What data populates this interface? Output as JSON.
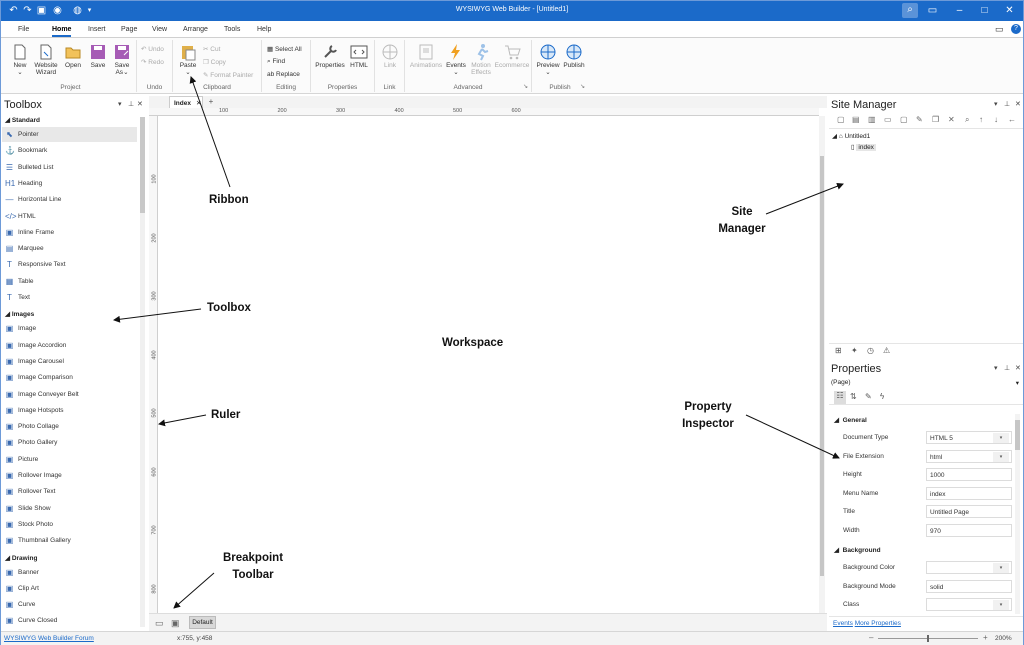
{
  "window": {
    "title": "WYSIWYG Web Builder - [Untitled1]"
  },
  "menu": [
    "File",
    "Home",
    "Insert",
    "Page",
    "View",
    "Arrange",
    "Tools",
    "Help"
  ],
  "menu_active": "Home",
  "ribbon": {
    "groups": [
      "Project",
      "Undo",
      "Clipboard",
      "Editing",
      "Properties",
      "Link",
      "Advanced",
      "Publish"
    ],
    "project": {
      "new": "New",
      "wizard1": "Website",
      "wizard2": "Wizard",
      "open": "Open",
      "save": "Save",
      "saveas1": "Save",
      "saveas2": "As"
    },
    "undo": {
      "undo": "Undo",
      "redo": "Redo"
    },
    "clipboard": {
      "paste": "Paste",
      "cut": "Cut",
      "copy": "Copy",
      "format_painter": "Format Painter"
    },
    "editing": {
      "select_all": "Select All",
      "find": "Find",
      "replace": "Replace"
    },
    "properties": {
      "properties": "Properties",
      "html": "HTML"
    },
    "link": {
      "link": "Link"
    },
    "advanced": {
      "animations": "Animations",
      "events": "Events",
      "motion1": "Motion",
      "motion2": "Effects",
      "ecommerce": "Ecommerce"
    },
    "publish": {
      "preview": "Preview",
      "publish": "Publish"
    }
  },
  "toolbox": {
    "title": "Toolbox",
    "sections": {
      "standard": "Standard",
      "images": "Images",
      "drawing": "Drawing"
    },
    "standard_items": [
      "Pointer",
      "Bookmark",
      "Bulleted List",
      "Heading",
      "Horizontal Line",
      "HTML",
      "Inline Frame",
      "Marquee",
      "Responsive Text",
      "Table",
      "Text"
    ],
    "image_items": [
      "Image",
      "Image Accordion",
      "Image Carousel",
      "Image Comparison",
      "Image Conveyer Belt",
      "Image Hotspots",
      "Photo Collage",
      "Photo Gallery",
      "Picture",
      "Rollover Image",
      "Rollover Text",
      "Slide Show",
      "Stock Photo",
      "Thumbnail Gallery"
    ],
    "drawing_items": [
      "Banner",
      "Clip Art",
      "Curve",
      "Curve Closed"
    ],
    "standard_icons": [
      "pointer-icon",
      "bookmark-icon",
      "list-icon",
      "heading-icon",
      "line-icon",
      "html-icon",
      "frame-icon",
      "marquee-icon",
      "text-icon",
      "table-icon",
      "text-icon"
    ],
    "standard_glyphs": [
      "⬉",
      "⚓",
      "☰",
      "H1",
      "—",
      "</>",
      "▣",
      "▤",
      "T",
      "▦",
      "T"
    ]
  },
  "document": {
    "tab": "Index",
    "add_tab": "+"
  },
  "ruler": {
    "h": [
      "100",
      "200",
      "300",
      "400",
      "500",
      "600"
    ],
    "v": [
      "100",
      "200",
      "300",
      "400",
      "500",
      "600",
      "700",
      "800"
    ]
  },
  "breakpoint": {
    "default": "Default"
  },
  "site_manager": {
    "title": "Site Manager",
    "root": "Untitled1",
    "page": "index"
  },
  "properties": {
    "title": "Properties",
    "object": "(Page)",
    "general": "General",
    "rows": [
      {
        "name": "Document Type",
        "value": "HTML 5",
        "dropdown": true
      },
      {
        "name": "File Extension",
        "value": "html",
        "dropdown": true
      },
      {
        "name": "Height",
        "value": "1000",
        "dropdown": false
      },
      {
        "name": "Menu Name",
        "value": "index",
        "dropdown": false
      },
      {
        "name": "Title",
        "value": "Untitled Page",
        "dropdown": false
      },
      {
        "name": "Width",
        "value": "970",
        "dropdown": false
      }
    ],
    "background": "Background",
    "bg_rows": [
      {
        "name": "Background Color",
        "value": "",
        "dropdown": true
      },
      {
        "name": "Background Mode",
        "value": "solid",
        "dropdown": false
      },
      {
        "name": "Class",
        "value": "",
        "dropdown": true
      }
    ],
    "footer_events": "Events",
    "footer_more": "More Properties"
  },
  "status": {
    "forum": "WYSIWYG Web Builder Forum",
    "coords": "x:755, y:458",
    "zoom": "200%"
  },
  "annotations": {
    "ribbon": "Ribbon",
    "toolbox": "Toolbox",
    "ruler": "Ruler",
    "workspace": "Workspace",
    "site_manager_1": "Site",
    "site_manager_2": "Manager",
    "property_1": "Property",
    "property_2": "Inspector",
    "breakpoint_1": "Breakpoint",
    "breakpoint_2": "Toolbar"
  },
  "colors": {
    "titlebar": "#1b6ac9",
    "accent": "#1b6ac9"
  }
}
